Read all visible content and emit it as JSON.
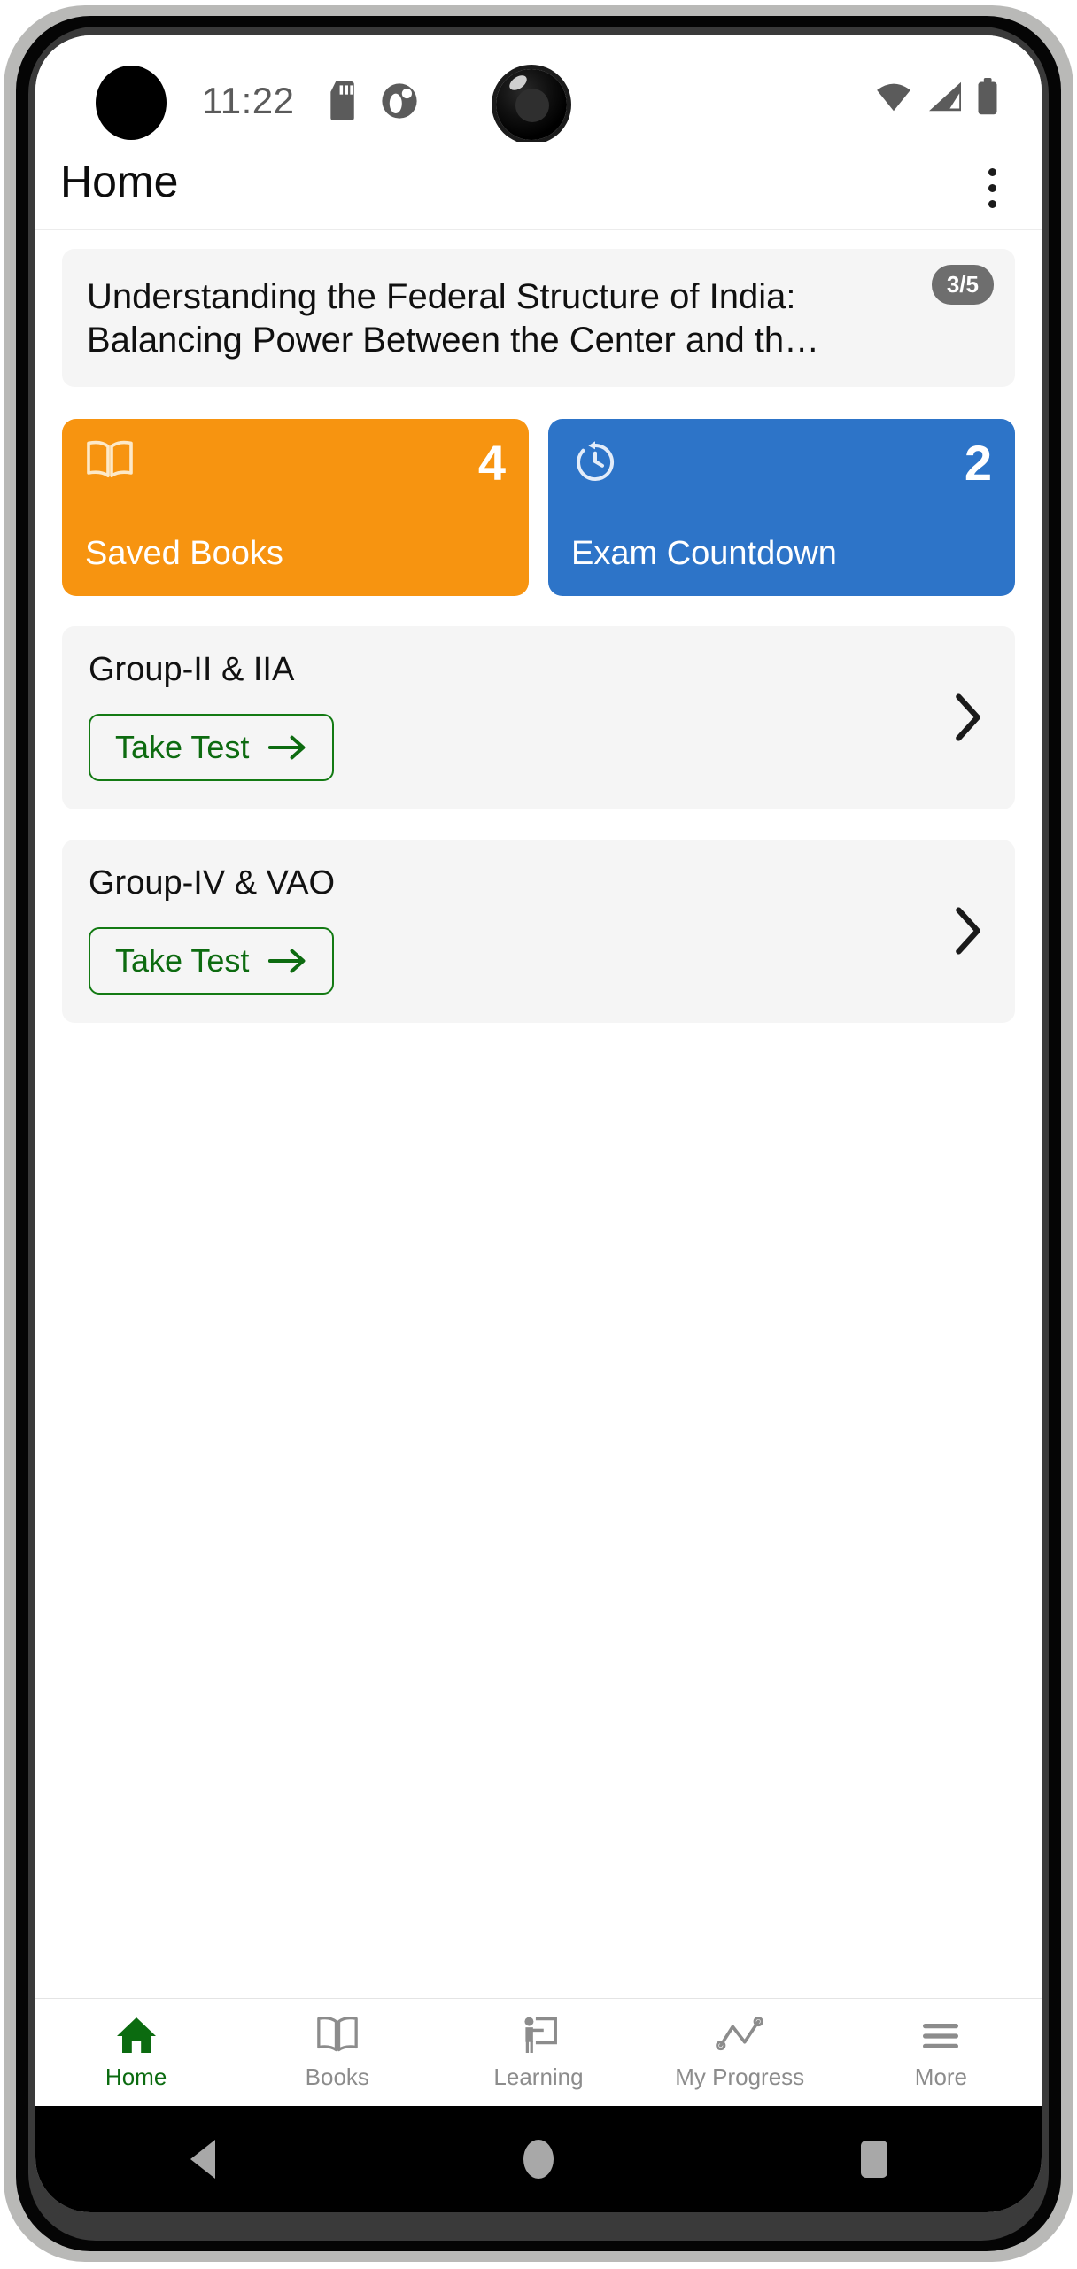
{
  "status_bar": {
    "time": "11:22",
    "sd_card_icon": "sd-card-icon",
    "notification_icon": "notification-dot-icon",
    "wifi_icon": "wifi-icon",
    "signal_icon": "cellular-signal-icon",
    "battery_icon": "battery-icon"
  },
  "app_bar": {
    "title": "Home",
    "overflow_label": "overflow-menu-icon"
  },
  "article": {
    "title": "Understanding the Federal Structure of India:\nBalancing Power Between the Center and th…",
    "badge": "3/5"
  },
  "stats": [
    {
      "label": "Saved Books",
      "count": "4",
      "icon": "open-book-icon",
      "color": "#f79410"
    },
    {
      "label": "Exam Countdown",
      "count": "2",
      "icon": "stopwatch-icon",
      "color": "#2d74c8"
    }
  ],
  "groups": [
    {
      "title": "Group-II & IIA",
      "button_label": "Take Test",
      "chevron": "chevron-right-icon"
    },
    {
      "title": "Group-IV & VAO",
      "button_label": "Take Test",
      "chevron": "chevron-right-icon"
    }
  ],
  "bottom_nav": [
    {
      "label": "Home",
      "icon": "home-icon",
      "active": true
    },
    {
      "label": "Books",
      "icon": "book-icon",
      "active": false
    },
    {
      "label": "Learning",
      "icon": "teacher-board-icon",
      "active": false
    },
    {
      "label": "My Progress",
      "icon": "line-chart-icon",
      "active": false
    },
    {
      "label": "More",
      "icon": "hamburger-menu-icon",
      "active": false
    }
  ],
  "android_nav": {
    "back": "back-triangle-icon",
    "home": "home-circle-icon",
    "recents": "recents-square-icon"
  },
  "colors": {
    "accent_green": "#0b6b10",
    "orange": "#f79410",
    "blue": "#2d74c8",
    "card_bg": "#f5f5f5",
    "badge_gray": "#6e6e6e"
  }
}
